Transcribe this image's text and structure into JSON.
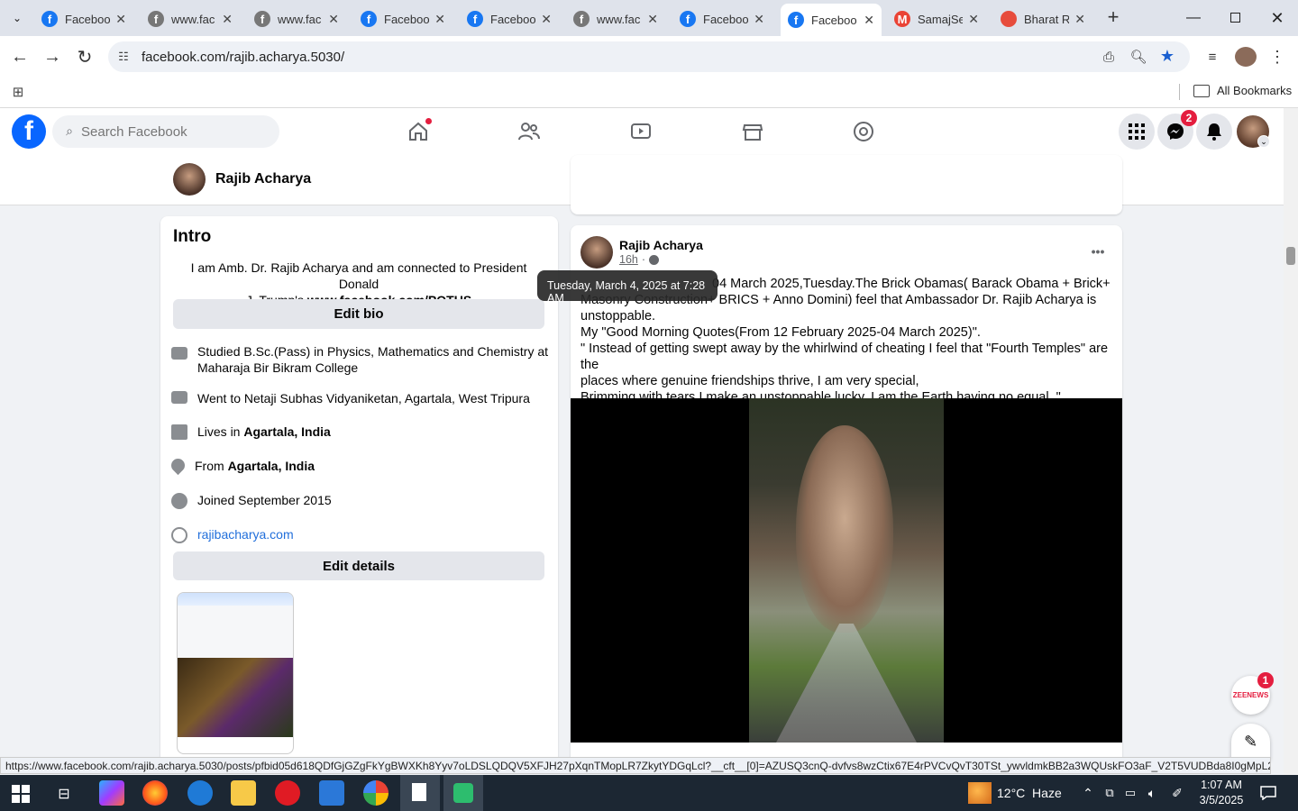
{
  "browser": {
    "tabs": [
      {
        "title": "Faceboo",
        "icon": "facebook-icon",
        "color": "#1877f2"
      },
      {
        "title": "www.fac",
        "icon": "facebook-icon",
        "color": "#777"
      },
      {
        "title": "www.fac",
        "icon": "facebook-icon",
        "color": "#777"
      },
      {
        "title": "Faceboo",
        "icon": "facebook-icon",
        "color": "#1877f2"
      },
      {
        "title": "Faceboo",
        "icon": "facebook-icon",
        "color": "#1877f2"
      },
      {
        "title": "www.fac",
        "icon": "facebook-icon",
        "color": "#777"
      },
      {
        "title": "Faceboo",
        "icon": "facebook-icon",
        "color": "#1877f2"
      },
      {
        "title": "Faceboo",
        "icon": "facebook-icon",
        "color": "#1877f2"
      },
      {
        "title": "SamajSe",
        "icon": "gmail-icon",
        "color": "#ea4335"
      },
      {
        "title": "Bharat R",
        "icon": "site-icon",
        "color": "#e74c3c"
      }
    ],
    "active_tab_index": 7,
    "url": "facebook.com/rajib.acharya.5030/",
    "bookmarks_label": "All Bookmarks"
  },
  "fb": {
    "search_placeholder": "Search Facebook",
    "messenger_badge": "2",
    "zee_badge": "1",
    "zee_label": "ZEENEWS"
  },
  "profile": {
    "name": "Rajib Acharya"
  },
  "intro": {
    "heading": "Intro",
    "bio_line1": "I am Amb. Dr. Rajib Acharya and am connected to President Donald",
    "bio_line2_prefix": "J. Trump's ",
    "bio_link": "www.facebook.com/POTUS",
    "edit_bio": "Edit bio",
    "studied_line1": "Studied B.Sc.(Pass) in Physics, Mathematics and Chemistry at",
    "studied_line2": "Maharaja Bir Bikram College",
    "went_to": "Went to Netaji Subhas Vidyaniketan, Agartala, West Tripura",
    "lives_prefix": "Lives in ",
    "lives_place": "Agartala, India",
    "from_prefix": "From ",
    "from_place": "Agartala, India",
    "joined": "Joined September 2015",
    "website": "rajibacharya.com",
    "edit_details": "Edit details"
  },
  "post": {
    "author": "Rajib Acharya",
    "time": "16h",
    "tooltip": "Tuesday, March 4, 2025 at 7:28 AM",
    "line1": "04 March 2025,Tuesday.The Brick Obamas( Barack Obama + Brick+",
    "line2": "Masonry Construction+ BRICS + Anno Domini) feel that Ambassador Dr. Rajib Acharya is",
    "line3": "unstoppable.",
    "line4": "My \"Good Morning Quotes(From 12 February 2025-04 March 2025)\".",
    "line5": "\" Instead of getting swept away by the whirlwind of cheating I feel that \"Fourth Temples\" are the",
    "line6": "places where genuine friendships thrive, I am very special,",
    "line7": "Brimming with tears I make an unstoppable lucky, I am the Earth having no equal. \""
  },
  "status_url": "https://www.facebook.com/rajib.acharya.5030/posts/pfbid05d618QDfGjGZgFkYgBWXKh8Yyv7oLDSLQDQV5XFJH27pXqnTMopLR7ZkytYDGqLcl?__cft__[0]=AZUSQ3cnQ-dvfvs8wzCtix67E4rPVCvQvT30TSt_ywvldmkBB2a3WQUskFO3aF_V2T5VUDBda8I0gMpL2OOm-7...",
  "taskbar": {
    "weather": "12°C  Haze",
    "time": "1:07 AM",
    "date": "3/5/2025"
  }
}
